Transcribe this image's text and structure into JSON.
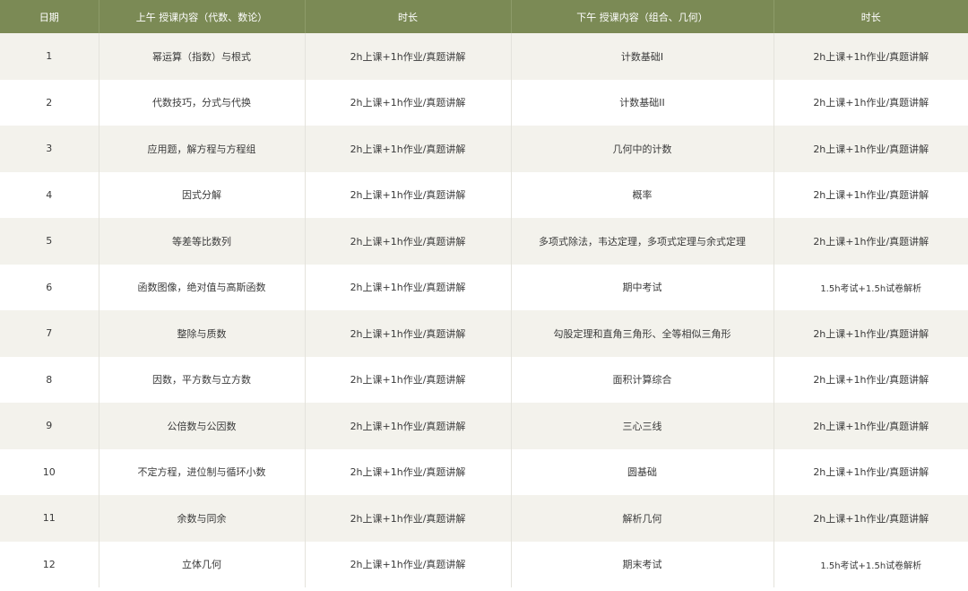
{
  "table": {
    "headers": [
      "日期",
      "上午 授课内容（代数、数论）",
      "时长",
      "下午 授课内容（组合、几何）",
      "时长"
    ],
    "rows": [
      {
        "day": "1",
        "am": "幂运算（指数）与根式",
        "am_dur": "2h上课+1h作业/真题讲解",
        "pm": "计数基础I",
        "pm_dur": "2h上课+1h作业/真题讲解"
      },
      {
        "day": "2",
        "am": "代数技巧，分式与代换",
        "am_dur": "2h上课+1h作业/真题讲解",
        "pm": "计数基础II",
        "pm_dur": "2h上课+1h作业/真题讲解"
      },
      {
        "day": "3",
        "am": "应用题，解方程与方程组",
        "am_dur": "2h上课+1h作业/真题讲解",
        "pm": "几何中的计数",
        "pm_dur": "2h上课+1h作业/真题讲解"
      },
      {
        "day": "4",
        "am": "因式分解",
        "am_dur": "2h上课+1h作业/真题讲解",
        "pm": "概率",
        "pm_dur": "2h上课+1h作业/真题讲解"
      },
      {
        "day": "5",
        "am": "等差等比数列",
        "am_dur": "2h上课+1h作业/真题讲解",
        "pm": "多项式除法，韦达定理，多项式定理与余式定理",
        "pm_dur": "2h上课+1h作业/真题讲解"
      },
      {
        "day": "6",
        "am": "函数图像，绝对值与高斯函数",
        "am_dur": "2h上课+1h作业/真题讲解",
        "pm": "期中考试",
        "pm_dur": "1.5h考试+1.5h试卷解析"
      },
      {
        "day": "7",
        "am": "整除与质数",
        "am_dur": "2h上课+1h作业/真题讲解",
        "pm": "勾股定理和直角三角形、全等相似三角形",
        "pm_dur": "2h上课+1h作业/真题讲解"
      },
      {
        "day": "8",
        "am": "因数，平方数与立方数",
        "am_dur": "2h上课+1h作业/真题讲解",
        "pm": "面积计算综合",
        "pm_dur": "2h上课+1h作业/真题讲解"
      },
      {
        "day": "9",
        "am": "公倍数与公因数",
        "am_dur": "2h上课+1h作业/真题讲解",
        "pm": "三心三线",
        "pm_dur": "2h上课+1h作业/真题讲解"
      },
      {
        "day": "10",
        "am": "不定方程，进位制与循环小数",
        "am_dur": "2h上课+1h作业/真题讲解",
        "pm": "圆基础",
        "pm_dur": "2h上课+1h作业/真题讲解"
      },
      {
        "day": "11",
        "am": "余数与同余",
        "am_dur": "2h上课+1h作业/真题讲解",
        "pm": "解析几何",
        "pm_dur": "2h上课+1h作业/真题讲解"
      },
      {
        "day": "12",
        "am": "立体几何",
        "am_dur": "2h上课+1h作业/真题讲解",
        "pm": "期末考试",
        "pm_dur": "1.5h考试+1.5h试卷解析"
      }
    ]
  },
  "colors": {
    "header_bg": "#7b8a55",
    "header_text": "#ffffff",
    "row_stripe": "#f3f2ec",
    "row_plain": "#ffffff",
    "cell_text": "#3a3a3a"
  }
}
